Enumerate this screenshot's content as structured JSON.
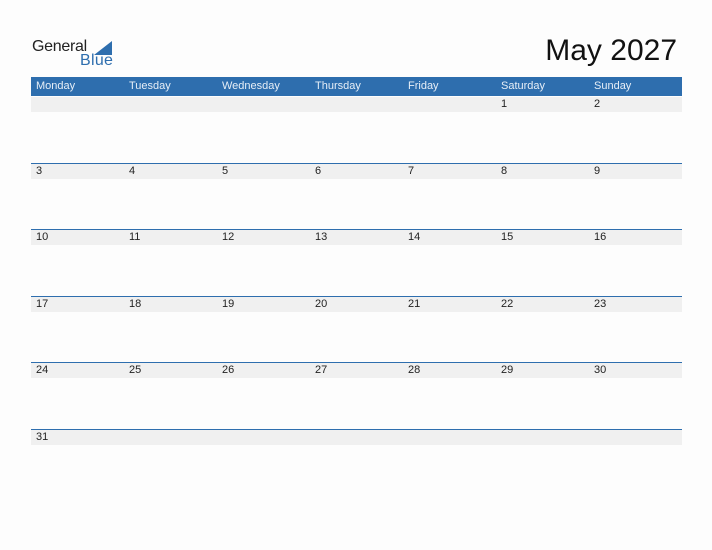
{
  "logo": {
    "text_top": "General",
    "text_bottom": "Blue",
    "icon": "blue-triangle-icon"
  },
  "title": "May 2027",
  "colors": {
    "accent": "#2E6EAE",
    "date_band": "#F0F0F0"
  },
  "weekdays": [
    "Monday",
    "Tuesday",
    "Wednesday",
    "Thursday",
    "Friday",
    "Saturday",
    "Sunday"
  ],
  "weeks": [
    [
      "",
      "",
      "",
      "",
      "",
      "1",
      "2"
    ],
    [
      "3",
      "4",
      "5",
      "6",
      "7",
      "8",
      "9"
    ],
    [
      "10",
      "11",
      "12",
      "13",
      "14",
      "15",
      "16"
    ],
    [
      "17",
      "18",
      "19",
      "20",
      "21",
      "22",
      "23"
    ],
    [
      "24",
      "25",
      "26",
      "27",
      "28",
      "29",
      "30"
    ],
    [
      "31",
      "",
      "",
      "",
      "",
      "",
      ""
    ]
  ]
}
